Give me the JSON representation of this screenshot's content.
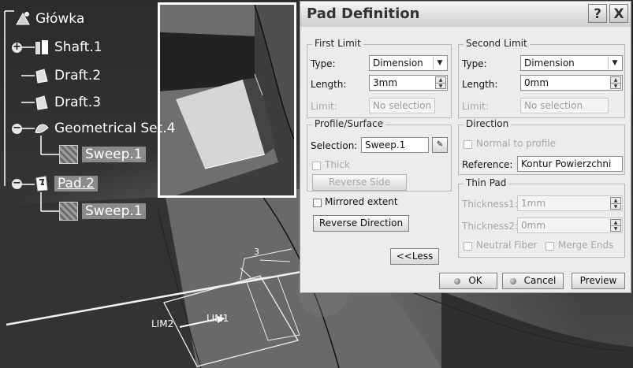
{
  "tree": {
    "root": "Główka",
    "items": [
      {
        "label": "Shaft.1"
      },
      {
        "label": "Draft.2"
      },
      {
        "label": "Draft.3"
      },
      {
        "label": "Geometrical Set.4"
      },
      {
        "label": "Sweep.1"
      },
      {
        "label": "Pad.2"
      },
      {
        "label": "Sweep.1"
      }
    ]
  },
  "viewport": {
    "labels": {
      "three": "3",
      "lim2": "LIM2",
      "lim1": "LIM1"
    }
  },
  "dialog": {
    "title": "Pad Definition",
    "help_button": "?",
    "close_button": "X",
    "first_limit": {
      "group_label": "First Limit",
      "type_label": "Type:",
      "type_value": "Dimension",
      "length_label": "Length:",
      "length_value": "3mm",
      "limit_label": "Limit:",
      "limit_value": "No selection"
    },
    "second_limit": {
      "group_label": "Second Limit",
      "type_label": "Type:",
      "type_value": "Dimension",
      "length_label": "Length:",
      "length_value": "0mm",
      "limit_label": "Limit:",
      "limit_value": "No selection"
    },
    "profile": {
      "group_label": "Profile/Surface",
      "selection_label": "Selection:",
      "selection_value": "Sweep.1",
      "thick_label": "Thick",
      "reverse_side": "Reverse Side"
    },
    "direction": {
      "group_label": "Direction",
      "normal_label": "Normal to profile",
      "reference_label": "Reference:",
      "reference_value": "Kontur Powierzchni"
    },
    "mirrored_label": "Mirrored extent",
    "reverse_direction": "Reverse Direction",
    "thin_pad": {
      "group_label": "Thin Pad",
      "thickness1_label": "Thickness1:",
      "thickness1_value": "1mm",
      "thickness2_label": "Thickness2:",
      "thickness2_value": "0mm",
      "neutral_label": "Neutral Fiber",
      "merge_label": "Merge Ends"
    },
    "less_button": "<<Less",
    "ok": "OK",
    "cancel": "Cancel",
    "preview": "Preview"
  }
}
